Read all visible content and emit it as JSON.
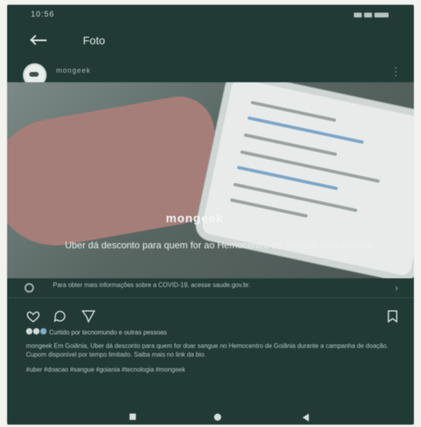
{
  "status_bar": {
    "time": "10:56"
  },
  "header": {
    "title": "Foto"
  },
  "post": {
    "username": "mongeek",
    "photo": {
      "brand": "mongeek",
      "caption": "Uber dá desconto para quem for ao Hemocentro de Goiânia doar sangue"
    },
    "info_banner": {
      "text": "Para obter mais informações sobre a COVID-19, acesse saude.gov.br."
    },
    "likes_text": "Curtido por tecnomundo e outras pessoas",
    "description": "mongeek Em Goiânia, Uber dá desconto para quem for doar sangue no Hemocentro de Goiânia durante a campanha de doação. Cupom disponível por tempo limitado. Saiba mais no link da bio.",
    "extra_description": "#uber #doacao #sangue #goiania #tecnologia #mongeek"
  },
  "colors": {
    "app_background": "#213a36",
    "text_light": "#e7ede9"
  }
}
